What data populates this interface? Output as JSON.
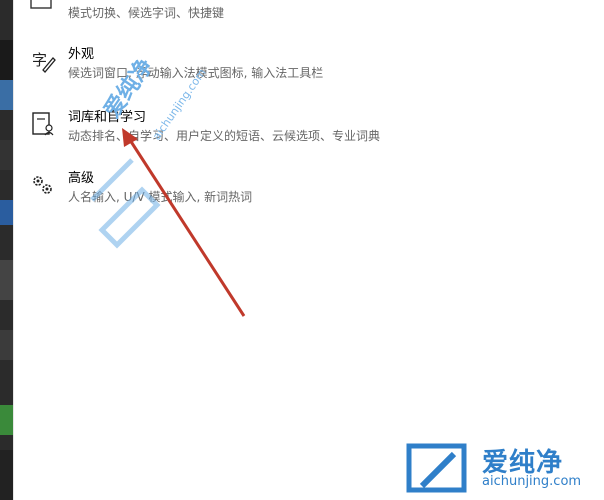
{
  "partial_top": {
    "desc": "模式切换、候选字词、快捷键"
  },
  "items": [
    {
      "title": "外观",
      "desc": "候选词窗口, 浮动输入法模式图标, 输入法工具栏",
      "icon": "appearance-icon"
    },
    {
      "title": "词库和自学习",
      "desc": "动态排名、自学习、用户定义的短语、云候选项、专业词典",
      "icon": "dictionary-icon"
    },
    {
      "title": "高级",
      "desc": "人名输入, U/V 模式输入, 新词热词",
      "icon": "gears-icon"
    }
  ],
  "watermark": {
    "text": "爱纯净",
    "url": "aichunjing.com"
  },
  "logo": {
    "brand": "爱纯净",
    "url": "aichunjing.com"
  },
  "colors": {
    "accent": "#2f7fc9",
    "arrow": "#c0392b",
    "desc_gray": "#666666"
  }
}
